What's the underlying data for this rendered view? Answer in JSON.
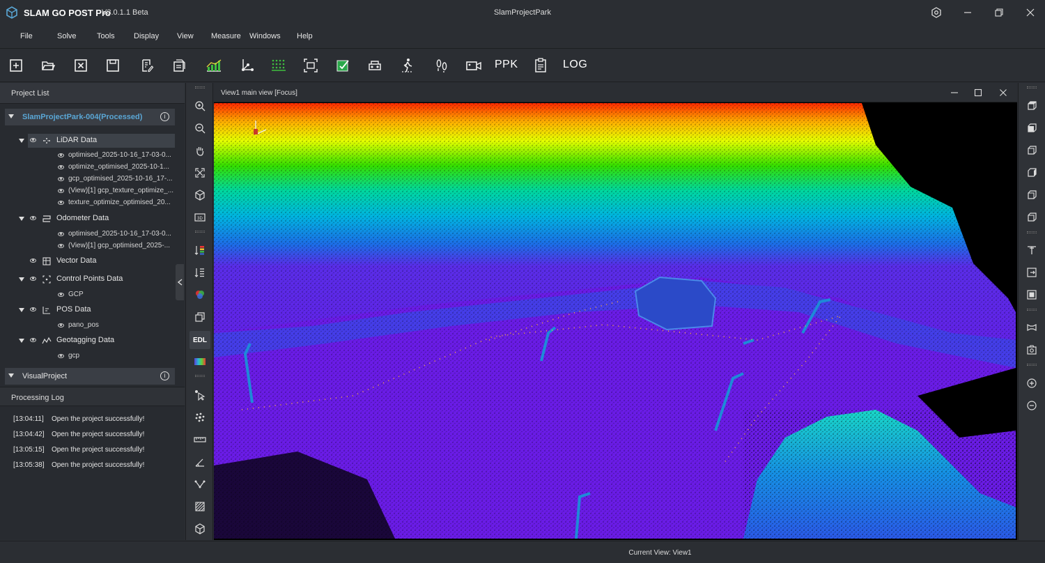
{
  "window": {
    "app_name": "SLAM GO POST Pro",
    "version": "V3.0.1.1 Beta",
    "document_title": "SlamProjectPark"
  },
  "menu": [
    "File",
    "Solve",
    "Tools",
    "Display",
    "View",
    "Measure",
    "Windows",
    "Help"
  ],
  "toolbar": {
    "icons": [
      "new-project-icon",
      "open-folder-icon",
      "close-project-icon",
      "save-icon",
      "edit-list-icon",
      "batch-process-icon",
      "lidar-solve-icon",
      "coordinate-axes-icon",
      "point-grid-icon",
      "crop-frame-icon",
      "export-check-icon",
      "vehicle-icon",
      "walk-icon",
      "footprint-icon",
      "video-camera-icon"
    ],
    "ppk_label": "PPK",
    "clipboard_icon": "clipboard-icon",
    "log_label": "LOG"
  },
  "project_panel": {
    "title": "Project List",
    "project": "SlamProjectPark-004(Processed)",
    "groups": [
      {
        "label": "LiDAR Data",
        "icon": "point-cloud-icon",
        "expanded": true,
        "selected": true,
        "items": [
          "optimised_2025-10-16_17-03-0...",
          "optimize_optimised_2025-10-1...",
          "gcp_optimised_2025-10-16_17-...",
          "(View)[1] gcp_texture_optimize_...",
          "texture_optimize_optimised_20..."
        ]
      },
      {
        "label": "Odometer Data",
        "icon": "trajectory-icon",
        "expanded": true,
        "items": [
          "optimised_2025-10-16_17-03-0...",
          "(View)[1] gcp_optimised_2025-..."
        ]
      },
      {
        "label": "Vector Data",
        "icon": "vector-icon",
        "expanded": false,
        "items": []
      },
      {
        "label": "Control Points Data",
        "icon": "control-points-icon",
        "expanded": true,
        "items": [
          "GCP"
        ]
      },
      {
        "label": "POS Data",
        "icon": "pos-icon",
        "expanded": true,
        "items": [
          "pano_pos"
        ]
      },
      {
        "label": "Geotagging Data",
        "icon": "geotag-icon",
        "expanded": true,
        "items": [
          "gcp"
        ]
      }
    ],
    "visual_project": "VisualProject"
  },
  "log_panel": {
    "title": "Processing Log",
    "entries": [
      {
        "time": "[13:04:11]",
        "message": "Open the project successfully!"
      },
      {
        "time": "[13:04:42]",
        "message": "Open the project successfully!"
      },
      {
        "time": "[13:05:15]",
        "message": "Open the project successfully!"
      },
      {
        "time": "[13:05:38]",
        "message": "Open the project successfully!"
      }
    ]
  },
  "view_tools": {
    "edl_label": "EDL"
  },
  "view": {
    "title": "View1 main view [Focus]"
  },
  "status": {
    "current_view": "Current View: View1"
  },
  "colors": {
    "accent": "#5aa7d6",
    "panel": "#282b30",
    "toolbar": "#2b2e33"
  }
}
